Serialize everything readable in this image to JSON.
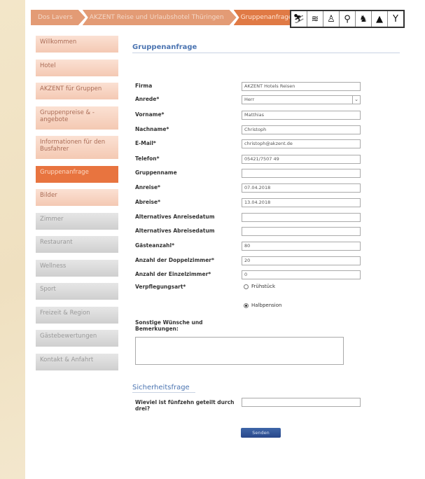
{
  "breadcrumb": [
    "Dos Lavers",
    "AKZENT Reise und Urlaubshotel Thüringen",
    "Gruppenanfrage"
  ],
  "icons": [
    "ski-icon",
    "wifi-icon",
    "hiker-icon",
    "bike-icon",
    "dog-icon",
    "drop-icon",
    "cocktail-icon"
  ],
  "sidebar": [
    {
      "label": "Willkommen",
      "style": "peach"
    },
    {
      "label": "Hotel",
      "style": "peach"
    },
    {
      "label": "AKZENT für Gruppen",
      "style": "peach"
    },
    {
      "label": "Gruppenpreise & -angebote",
      "style": "peach"
    },
    {
      "label": "Informationen für den Busfahrer",
      "style": "peach"
    },
    {
      "label": "Gruppenanfrage",
      "style": "active"
    },
    {
      "label": "Bilder",
      "style": "peach"
    },
    {
      "label": "Zimmer",
      "style": "gray"
    },
    {
      "label": "Restaurant",
      "style": "gray"
    },
    {
      "label": "Wellness",
      "style": "gray"
    },
    {
      "label": "Sport",
      "style": "gray"
    },
    {
      "label": "Freizeit & Region",
      "style": "gray"
    },
    {
      "label": "Gästebewertungen",
      "style": "gray"
    },
    {
      "label": "Kontakt & Anfahrt",
      "style": "gray"
    }
  ],
  "form": {
    "title": "Gruppenanfrage",
    "fields": [
      {
        "label": "Firma",
        "value": "AKZENT Hotels Reisen"
      },
      {
        "label": "Anrede*",
        "value": "Herr",
        "select": true
      },
      {
        "label": "Vorname*",
        "value": "Matthias"
      },
      {
        "label": "Nachname*",
        "value": "Christoph"
      },
      {
        "label": "E-Mail*",
        "value": "christoph@akzent.de"
      },
      {
        "label": "Telefon*",
        "value": "05421/7507 49"
      },
      {
        "label": "Gruppenname",
        "value": ""
      },
      {
        "label": "Anreise*",
        "value": "07.04.2018"
      },
      {
        "label": "Abreise*",
        "value": "13.04.2018"
      },
      {
        "label": "Alternatives Anreisedatum",
        "value": ""
      },
      {
        "label": "Alternatives Abreisedatum",
        "value": ""
      },
      {
        "label": "Gästeanzahl*",
        "value": "80"
      },
      {
        "label": "Anzahl der Doppelzimmer*",
        "value": "20"
      },
      {
        "label": "Anzahl der Einzelzimmer*",
        "value": "0"
      }
    ],
    "verpflegung_label": "Verpflegungsart*",
    "verpflegung_options": [
      {
        "label": "Frühstück",
        "selected": false
      },
      {
        "label": "Halbpension",
        "selected": true
      }
    ],
    "wishes_label": "Sonstige Wünsche und Bemerkungen:",
    "security_title": "Sicherheitsfrage",
    "security_question": "Wieviel ist fünfzehn geteilt durch drei?",
    "security_answer": "",
    "submit_label": "Senden"
  }
}
